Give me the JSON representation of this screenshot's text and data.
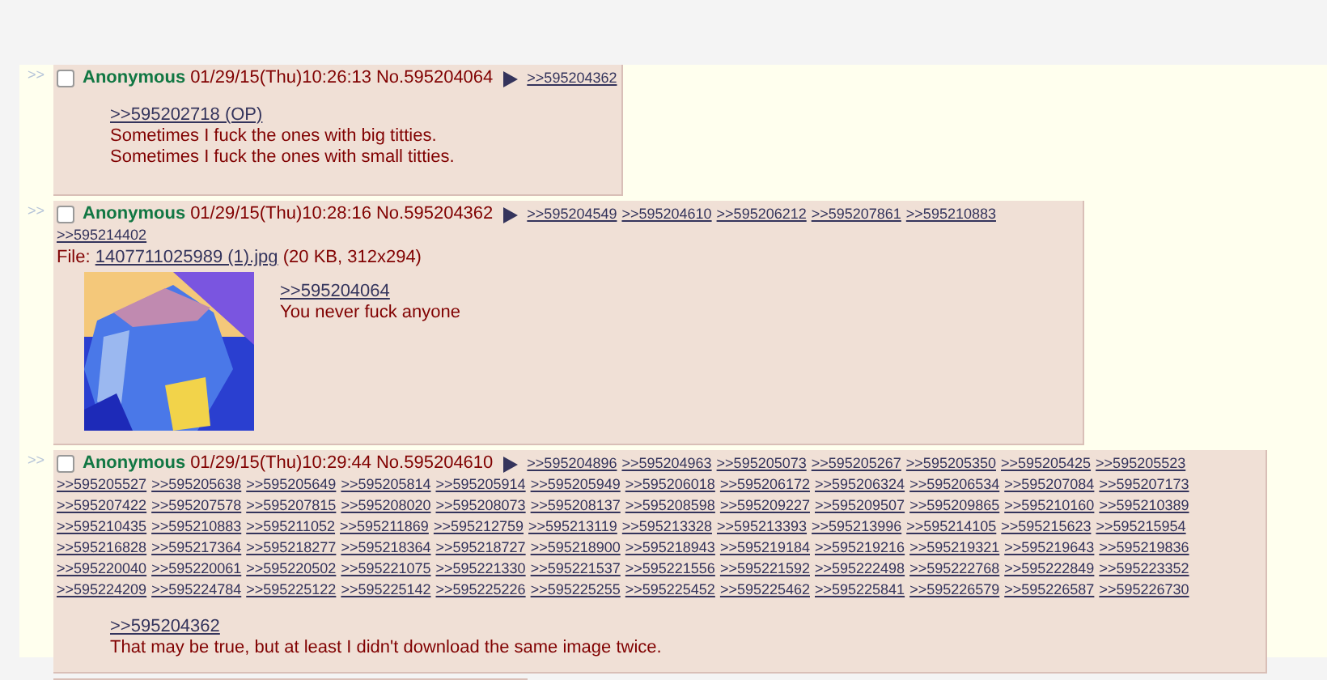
{
  "posts": [
    {
      "side_mark": ">>",
      "checked": false,
      "name": "Anonymous",
      "datetime": "01/29/15(Thu)10:26:13",
      "number": "No.595204064",
      "backlinks": [
        ">>595204362"
      ],
      "quote_link": ">>595202718 (OP)",
      "comment": [
        "Sometimes I fuck the ones with big titties.",
        "Sometimes I fuck the ones with small titties."
      ]
    },
    {
      "side_mark": ">>",
      "checked": false,
      "name": "Anonymous",
      "datetime": "01/29/15(Thu)10:28:16",
      "number": "No.595204362",
      "backlinks": [
        ">>595204549",
        ">>595204610",
        ">>595206212",
        ">>595207861",
        ">>595210883",
        ">>595214402"
      ],
      "file": {
        "label": "File:",
        "link": "1407711025989 (1).jpg",
        "info": "(20 KB, 312x294)",
        "kind": "picture"
      },
      "quote_link": ">>595204064",
      "comment": [
        "You never fuck anyone"
      ]
    },
    {
      "side_mark": ">>",
      "checked": false,
      "name": "Anonymous",
      "datetime": "01/29/15(Thu)10:29:44",
      "number": "No.595204610",
      "backlinks": [
        ">>595204896",
        ">>595204963",
        ">>595205073",
        ">>595205267",
        ">>595205350",
        ">>595205425",
        ">>595205523",
        ">>595205527",
        ">>595205638",
        ">>595205649",
        ">>595205814",
        ">>595205914",
        ">>595205949",
        ">>595206018",
        ">>595206172",
        ">>595206324",
        ">>595206534",
        ">>595207084",
        ">>595207173",
        ">>595207422",
        ">>595207578",
        ">>595207815",
        ">>595208020",
        ">>595208073",
        ">>595208137",
        ">>595208598",
        ">>595209227",
        ">>595209507",
        ">>595209865",
        ">>595210160",
        ">>595210389",
        ">>595210435",
        ">>595210883",
        ">>595211052",
        ">>595211869",
        ">>595212759",
        ">>595213119",
        ">>595213328",
        ">>595213393",
        ">>595213996",
        ">>595214105",
        ">>595215623",
        ">>595215954",
        ">>595216828",
        ">>595217364",
        ">>595218277",
        ">>595218364",
        ">>595218727",
        ">>595218900",
        ">>595218943",
        ">>595219184",
        ">>595219216",
        ">>595219321",
        ">>595219643",
        ">>595219836",
        ">>595220040",
        ">>595220061",
        ">>595220502",
        ">>595221075",
        ">>595221330",
        ">>595221537",
        ">>595221556",
        ">>595221592",
        ">>595222498",
        ">>595222768",
        ">>595222849",
        ">>595223352",
        ">>595224209",
        ">>595224784",
        ">>595225122",
        ">>595225142",
        ">>595225226",
        ">>595225255",
        ">>595225452",
        ">>595225462",
        ">>595225841",
        ">>595226579",
        ">>595226587",
        ">>595226730"
      ],
      "quote_link": ">>595204362",
      "comment": [
        "That may be true, but at least I didn't download the same image twice."
      ]
    }
  ]
}
